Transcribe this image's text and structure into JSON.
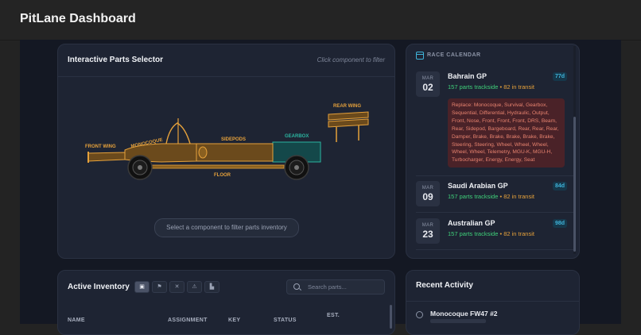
{
  "app": {
    "title": "PitLane Dashboard"
  },
  "parts_selector": {
    "title": "Interactive Parts Selector",
    "hint": "Click component to filter",
    "labels": {
      "front_wing": "FRONT WING",
      "monocoque": "MONOCOQUE",
      "sidepods": "SIDEPODS",
      "gearbox": "GEARBOX",
      "rear_wing": "REAR WING",
      "floor": "FLOOR"
    },
    "filter_prompt": "Select a component to filter parts inventory",
    "colors": {
      "part": "#e5a13b",
      "selected": "#2bb5a0"
    }
  },
  "calendar": {
    "title": "RACE CALENDAR",
    "races": [
      {
        "month": "MAR",
        "day": "02",
        "name": "Bahrain GP",
        "trackside": "157 parts trackside",
        "sep": "•",
        "transit": "82 in transit",
        "days": "77d",
        "replace": "Replace: Monocoque, Survival, Gearbox, Sequential, Differential, Hydraulic, Output, Front, Nose, Front, Front, Front, DRS, Beam, Rear, Sidepod, Bargeboard, Rear, Rear, Rear, Damper, Brake, Brake, Brake, Brake, Brake, Steering, Steering, Wheel, Wheel, Wheel, Wheel, Wheel, Telemetry, MGU-K, MGU-H, Turbocharger, Energy, Energy, Seat"
      },
      {
        "month": "MAR",
        "day": "09",
        "name": "Saudi Arabian GP",
        "trackside": "157 parts trackside",
        "sep": "•",
        "transit": "82 in transit",
        "days": "84d"
      },
      {
        "month": "MAR",
        "day": "23",
        "name": "Australian GP",
        "trackside": "157 parts trackside",
        "sep": "•",
        "transit": "82 in transit",
        "days": "98d"
      }
    ]
  },
  "inventory": {
    "title": "Active Inventory",
    "search_placeholder": "Search parts...",
    "filter_icons": [
      "cube-icon",
      "flag-icon",
      "tool-icon",
      "warning-icon",
      "factory-icon"
    ],
    "columns": [
      "NAME",
      "ASSIGNMENT",
      "KEY",
      "STATUS",
      "EST."
    ]
  },
  "activity": {
    "title": "Recent Activity",
    "items": [
      {
        "name": "Monocoque FW47 #2"
      }
    ]
  }
}
